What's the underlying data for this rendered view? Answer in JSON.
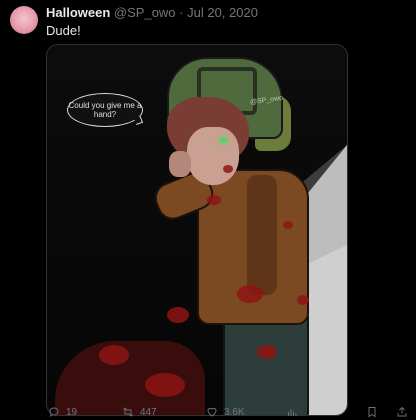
{
  "tweet": {
    "author_name": "Halloween",
    "handle": "@SP_owo",
    "separator": " · ",
    "date": "Jul 20, 2020",
    "text": "Dude!"
  },
  "media": {
    "speech_bubble": "Could you give me a hand?",
    "watermark": "@SP_owo"
  },
  "actions": {
    "replies": "19",
    "retweets": "447",
    "likes": "3.6K",
    "reply_icon": "reply-icon",
    "retweet_icon": "retweet-icon",
    "like_icon": "heart-icon",
    "views_icon": "views-icon",
    "bookmark_icon": "bookmark-icon",
    "share_icon": "share-icon"
  },
  "colors": {
    "background": "#000000",
    "text": "#e7e9ea",
    "muted": "#71767b"
  }
}
